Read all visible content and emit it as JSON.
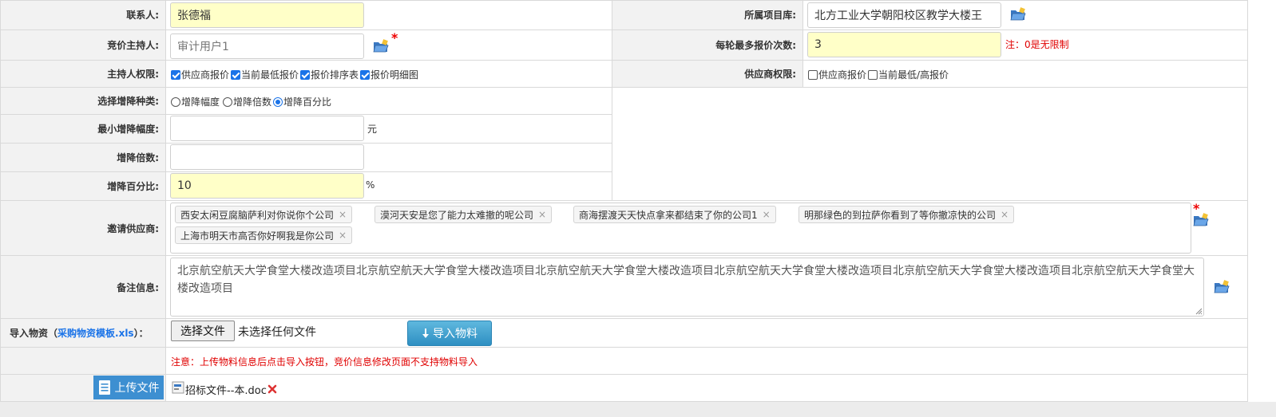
{
  "form": {
    "contact": {
      "label": "联系人:",
      "value": "张德福"
    },
    "project_lib": {
      "label": "所属项目库:",
      "value": "北方工业大学朝阳校区教学大楼王"
    },
    "host": {
      "label": "竞价主持人:",
      "placeholder": "审计用户1"
    },
    "max_quotes": {
      "label": "每轮最多报价次数:",
      "value": "3",
      "note": "注：0是无限制"
    },
    "host_perm": {
      "label": "主持人权限:",
      "options": [
        {
          "label": "供应商报价",
          "checked": true
        },
        {
          "label": "当前最低报价",
          "checked": true
        },
        {
          "label": "报价排序表",
          "checked": true
        },
        {
          "label": "报价明细图",
          "checked": true
        }
      ]
    },
    "supplier_perm": {
      "label": "供应商权限:",
      "options": [
        {
          "label": "供应商报价",
          "checked": false
        },
        {
          "label": "当前最低/高报价",
          "checked": false
        }
      ]
    },
    "change_type": {
      "label": "选择增降种类:",
      "options": [
        {
          "label": "增降幅度",
          "selected": false
        },
        {
          "label": "增降倍数",
          "selected": false
        },
        {
          "label": "增降百分比",
          "selected": true
        }
      ]
    },
    "min_change": {
      "label": "最小增降幅度:",
      "value": "",
      "unit": "元"
    },
    "multiple": {
      "label": "增降倍数:",
      "value": ""
    },
    "percent": {
      "label": "增降百分比:",
      "value": "10",
      "unit": "%"
    },
    "suppliers": {
      "label": "邀请供应商:",
      "tags": [
        "西安太闲豆腐脑萨利对你说你个公司",
        "漠河天安是您了能力太难撤的呢公司",
        "商海摆渡天天快点拿来都结束了你的公司1",
        "明那绿色的到拉萨你看到了等你撤凉快的公司",
        "上海市明天市高否你好啊我是你公司"
      ],
      "remove_glyph": "×"
    },
    "remarks": {
      "label": "备注信息:",
      "value": "北京航空航天大学食堂大楼改造项目北京航空航天大学食堂大楼改造项目北京航空航天大学食堂大楼改造项目北京航空航天大学食堂大楼改造项目北京航空航天大学食堂大楼改造项目北京航空航天大学食堂大楼改造项目"
    },
    "import": {
      "label_prefix": "导入物资（",
      "template_link": "采购物资模板.xls",
      "label_suffix": "）：",
      "choose_button": "选择文件",
      "no_file": "未选择任何文件",
      "import_button": "导入物料",
      "notice": "注意：上传物料信息后点击导入按钮，竞价信息修改页面不支持物料导入"
    },
    "upload": {
      "button": "上传文件",
      "file_name": "招标文件--本.doc"
    },
    "required_mark": "*"
  },
  "colors": {
    "accent": "#1a73e8",
    "required": "#e00000",
    "input_highlight": "#ffffc8",
    "label_bg": "#f2f2f2"
  },
  "icons": {
    "folder": "folder-open-icon",
    "arrow_down": "arrow-down-icon",
    "upload": "upload-document-icon",
    "delete": "delete-x-icon"
  }
}
